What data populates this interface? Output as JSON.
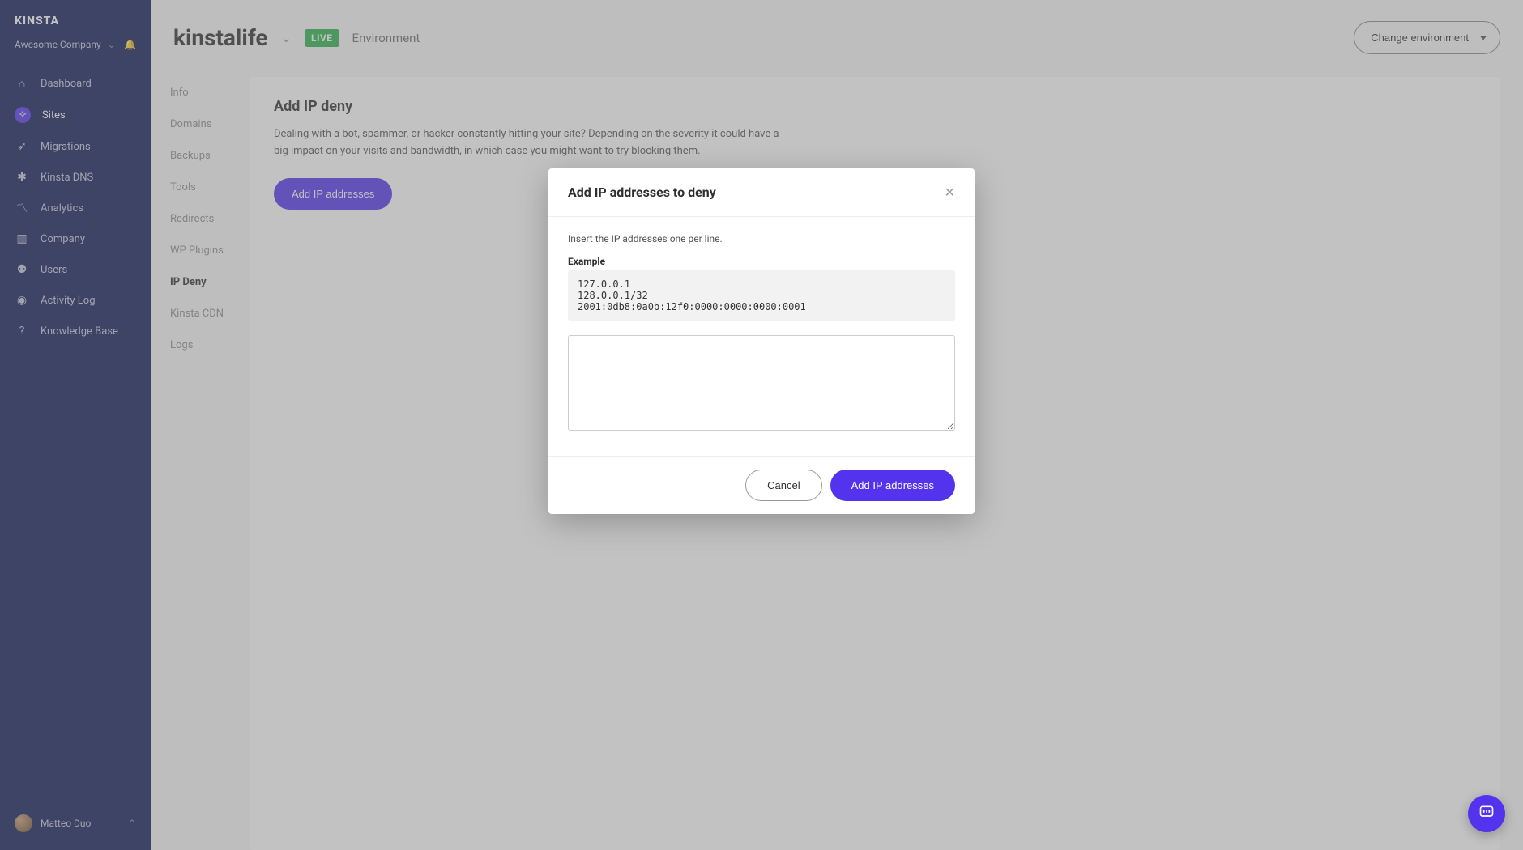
{
  "brand": "KINSTA",
  "company": {
    "name": "Awesome Company"
  },
  "nav": {
    "items": [
      {
        "label": "Dashboard",
        "icon": "⌂",
        "name": "nav-dashboard"
      },
      {
        "label": "Sites",
        "icon": "✧",
        "name": "nav-sites",
        "active": true
      },
      {
        "label": "Migrations",
        "icon": "➶",
        "name": "nav-migrations"
      },
      {
        "label": "Kinsta DNS",
        "icon": "✱",
        "name": "nav-kinsta-dns"
      },
      {
        "label": "Analytics",
        "icon": "〽",
        "name": "nav-analytics"
      },
      {
        "label": "Company",
        "icon": "▥",
        "name": "nav-company"
      },
      {
        "label": "Users",
        "icon": "⚉",
        "name": "nav-users"
      },
      {
        "label": "Activity Log",
        "icon": "◉",
        "name": "nav-activity-log"
      },
      {
        "label": "Knowledge Base",
        "icon": "?",
        "name": "nav-knowledge-base"
      }
    ]
  },
  "user": {
    "name": "Matteo Duo"
  },
  "header": {
    "site_name": "kinstalife",
    "env_badge": "LIVE",
    "env_label": "Environment",
    "change_env": "Change environment"
  },
  "subnav": {
    "items": [
      {
        "label": "Info",
        "name": "subnav-info"
      },
      {
        "label": "Domains",
        "name": "subnav-domains"
      },
      {
        "label": "Backups",
        "name": "subnav-backups"
      },
      {
        "label": "Tools",
        "name": "subnav-tools"
      },
      {
        "label": "Redirects",
        "name": "subnav-redirects"
      },
      {
        "label": "WP Plugins",
        "name": "subnav-wp-plugins"
      },
      {
        "label": "IP Deny",
        "name": "subnav-ip-deny",
        "active": true
      },
      {
        "label": "Kinsta CDN",
        "name": "subnav-kinsta-cdn"
      },
      {
        "label": "Logs",
        "name": "subnav-logs"
      }
    ]
  },
  "panel": {
    "title": "Add IP deny",
    "desc": "Dealing with a bot, spammer, or hacker constantly hitting your site? Depending on the severity it could have a big impact on your visits and bandwidth, in which case you might want to try blocking them.",
    "cta": "Add IP addresses"
  },
  "modal": {
    "title": "Add IP addresses to deny",
    "hint": "Insert the IP addresses one per line.",
    "example_label": "Example",
    "example_text": "127.0.0.1\n128.0.0.1/32\n2001:0db8:0a0b:12f0:0000:0000:0000:0001",
    "textarea_value": "",
    "cancel": "Cancel",
    "confirm": "Add IP addresses"
  }
}
